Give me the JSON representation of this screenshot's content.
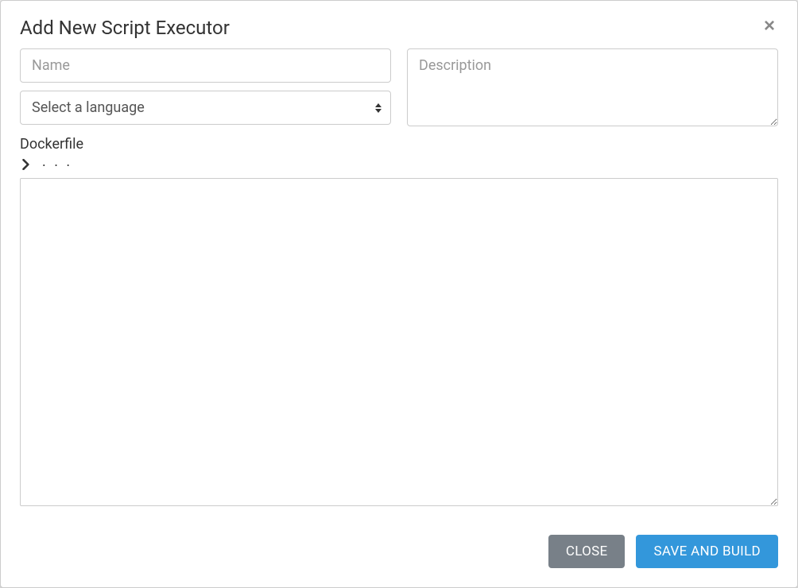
{
  "modal": {
    "title": "Add New Script Executor",
    "close_symbol": "×"
  },
  "form": {
    "name": {
      "placeholder": "Name",
      "value": ""
    },
    "description": {
      "placeholder": "Description",
      "value": ""
    },
    "language": {
      "placeholder": "Select a language",
      "selected": "Select a language"
    },
    "dockerfile": {
      "label": "Dockerfile",
      "collapsed_indicator": ". . .",
      "content": ""
    }
  },
  "footer": {
    "close_label": "CLOSE",
    "save_label": "SAVE AND BUILD"
  }
}
